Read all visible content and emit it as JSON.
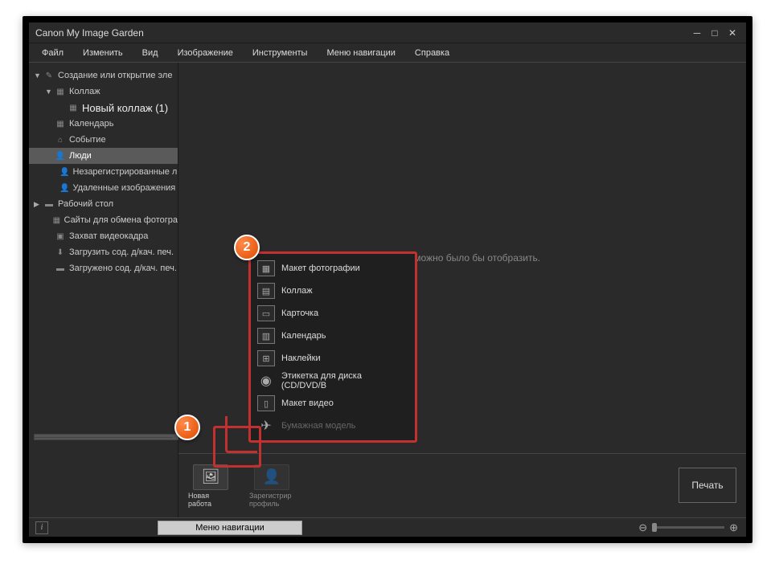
{
  "titlebar": {
    "title": "Canon My Image Garden"
  },
  "menubar": [
    "Файл",
    "Изменить",
    "Вид",
    "Изображение",
    "Инструменты",
    "Меню навигации",
    "Справка"
  ],
  "sidebar": {
    "items": [
      {
        "label": "Создание или открытие эле",
        "caret": "▼",
        "icon": "✎",
        "indent": 0
      },
      {
        "label": "Коллаж",
        "caret": "▼",
        "icon": "▦",
        "indent": 1
      },
      {
        "label": "Новый коллаж (1)",
        "caret": "",
        "icon": "▦",
        "indent": 2,
        "bold": true
      },
      {
        "label": "Календарь",
        "caret": "",
        "icon": "▦",
        "indent": 1
      },
      {
        "label": "Событие",
        "caret": "",
        "icon": "⌂",
        "indent": 1
      },
      {
        "label": "Люди",
        "caret": "",
        "icon": "👤",
        "indent": 1,
        "selected": true
      },
      {
        "label": "Незарегистрированные люд",
        "caret": "",
        "icon": "👤",
        "indent": 2
      },
      {
        "label": "Удаленные изображения ли",
        "caret": "",
        "icon": "👤",
        "indent": 2
      },
      {
        "label": "Рабочий стол",
        "caret": "▶",
        "icon": "▬",
        "indent": 0
      },
      {
        "label": "Сайты для обмена фотогра",
        "caret": "",
        "icon": "▦",
        "indent": 1
      },
      {
        "label": "Захват видеокадра",
        "caret": "",
        "icon": "▣",
        "indent": 1
      },
      {
        "label": "Загрузить сод. д/кач. печ.",
        "caret": "",
        "icon": "⬇",
        "indent": 1
      },
      {
        "label": "Загружено сод. д/кач. печ.",
        "caret": "",
        "icon": "▬",
        "indent": 1
      }
    ]
  },
  "main": {
    "empty_text": "торые можно было бы отобразить."
  },
  "popup": {
    "items": [
      {
        "label": "Макет фотографии",
        "icon": "▦"
      },
      {
        "label": "Коллаж",
        "icon": "▤"
      },
      {
        "label": "Карточка",
        "icon": "▭"
      },
      {
        "label": "Календарь",
        "icon": "▥"
      },
      {
        "label": "Наклейки",
        "icon": "⊞"
      },
      {
        "label": "Этикетка для диска (CD/DVD/B",
        "icon": "◉",
        "noborder": true
      },
      {
        "label": "Макет видео",
        "icon": "▯"
      },
      {
        "label": "Бумажная модель",
        "icon": "✈",
        "disabled": true,
        "noborder": true
      }
    ]
  },
  "footer": {
    "new_work": "Новая работа",
    "register_profile": "Зарегистрир профиль",
    "print": "Печать"
  },
  "statusbar": {
    "nav_menu": "Меню навигации"
  },
  "callouts": {
    "one": "1",
    "two": "2"
  }
}
